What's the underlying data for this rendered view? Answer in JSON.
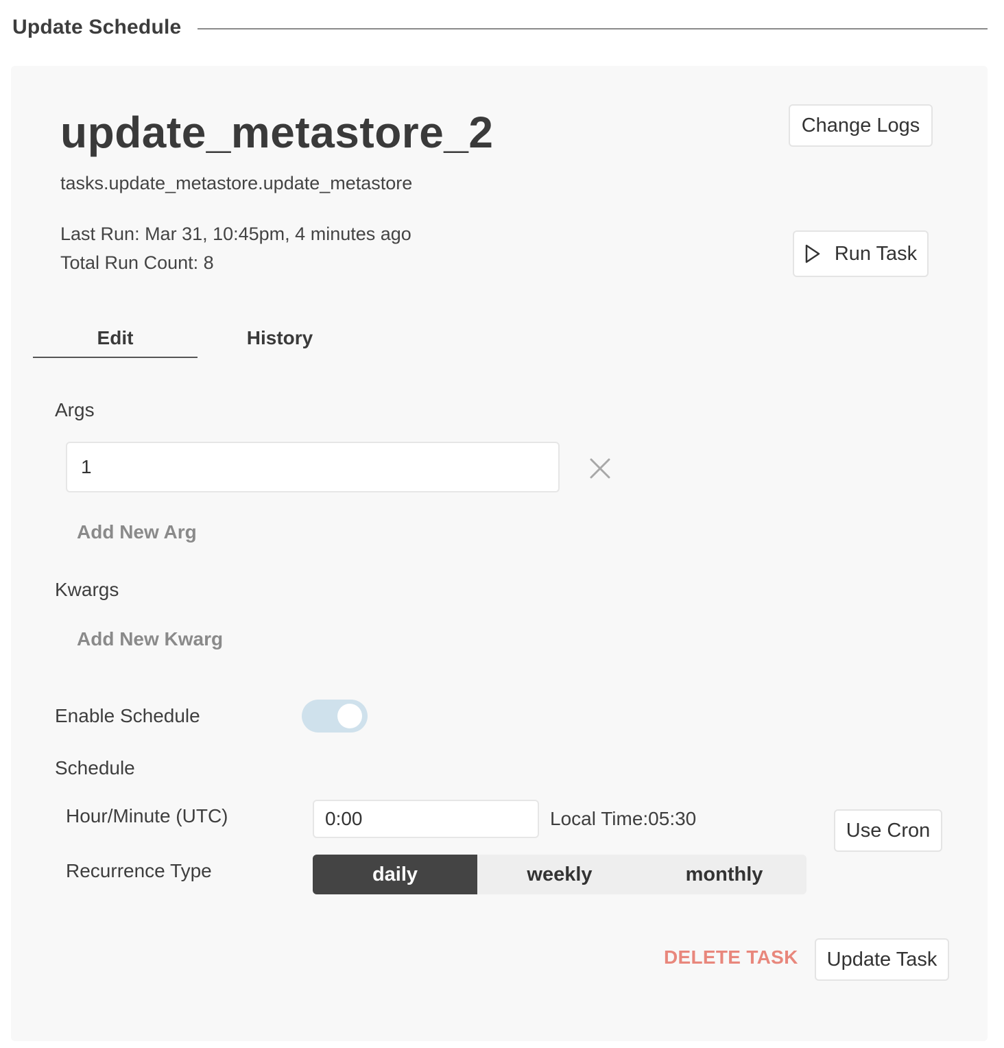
{
  "header": {
    "title": "Update Schedule"
  },
  "task": {
    "name": "update_metastore_2",
    "path": "tasks.update_metastore.update_metastore",
    "last_run": "Last Run: Mar 31, 10:45pm, 4 minutes ago",
    "run_count": "Total Run Count: 8"
  },
  "buttons": {
    "change_logs": "Change Logs",
    "run_task": "Run Task",
    "use_cron": "Use Cron",
    "update_task": "Update Task",
    "delete_task": "DELETE TASK"
  },
  "tabs": [
    {
      "label": "Edit",
      "active": true
    },
    {
      "label": "History",
      "active": false
    }
  ],
  "args": {
    "label": "Args",
    "items": [
      "1"
    ],
    "add_label": "Add New Arg"
  },
  "kwargs": {
    "label": "Kwargs",
    "add_label": "Add New Kwarg"
  },
  "schedule": {
    "enable_label": "Enable Schedule",
    "enabled": true,
    "label": "Schedule",
    "hour_minute_label": "Hour/Minute (UTC)",
    "hour_minute_value": "0:00",
    "local_time": "Local Time:05:30",
    "recurrence_label": "Recurrence Type",
    "recurrence_options": [
      "daily",
      "weekly",
      "monthly"
    ],
    "recurrence_selected": "daily"
  },
  "colors": {
    "accent_dark": "#444444",
    "toggle_on": "#cfe1ec",
    "danger": "#e8877c",
    "card_bg": "#f8f8f8"
  }
}
